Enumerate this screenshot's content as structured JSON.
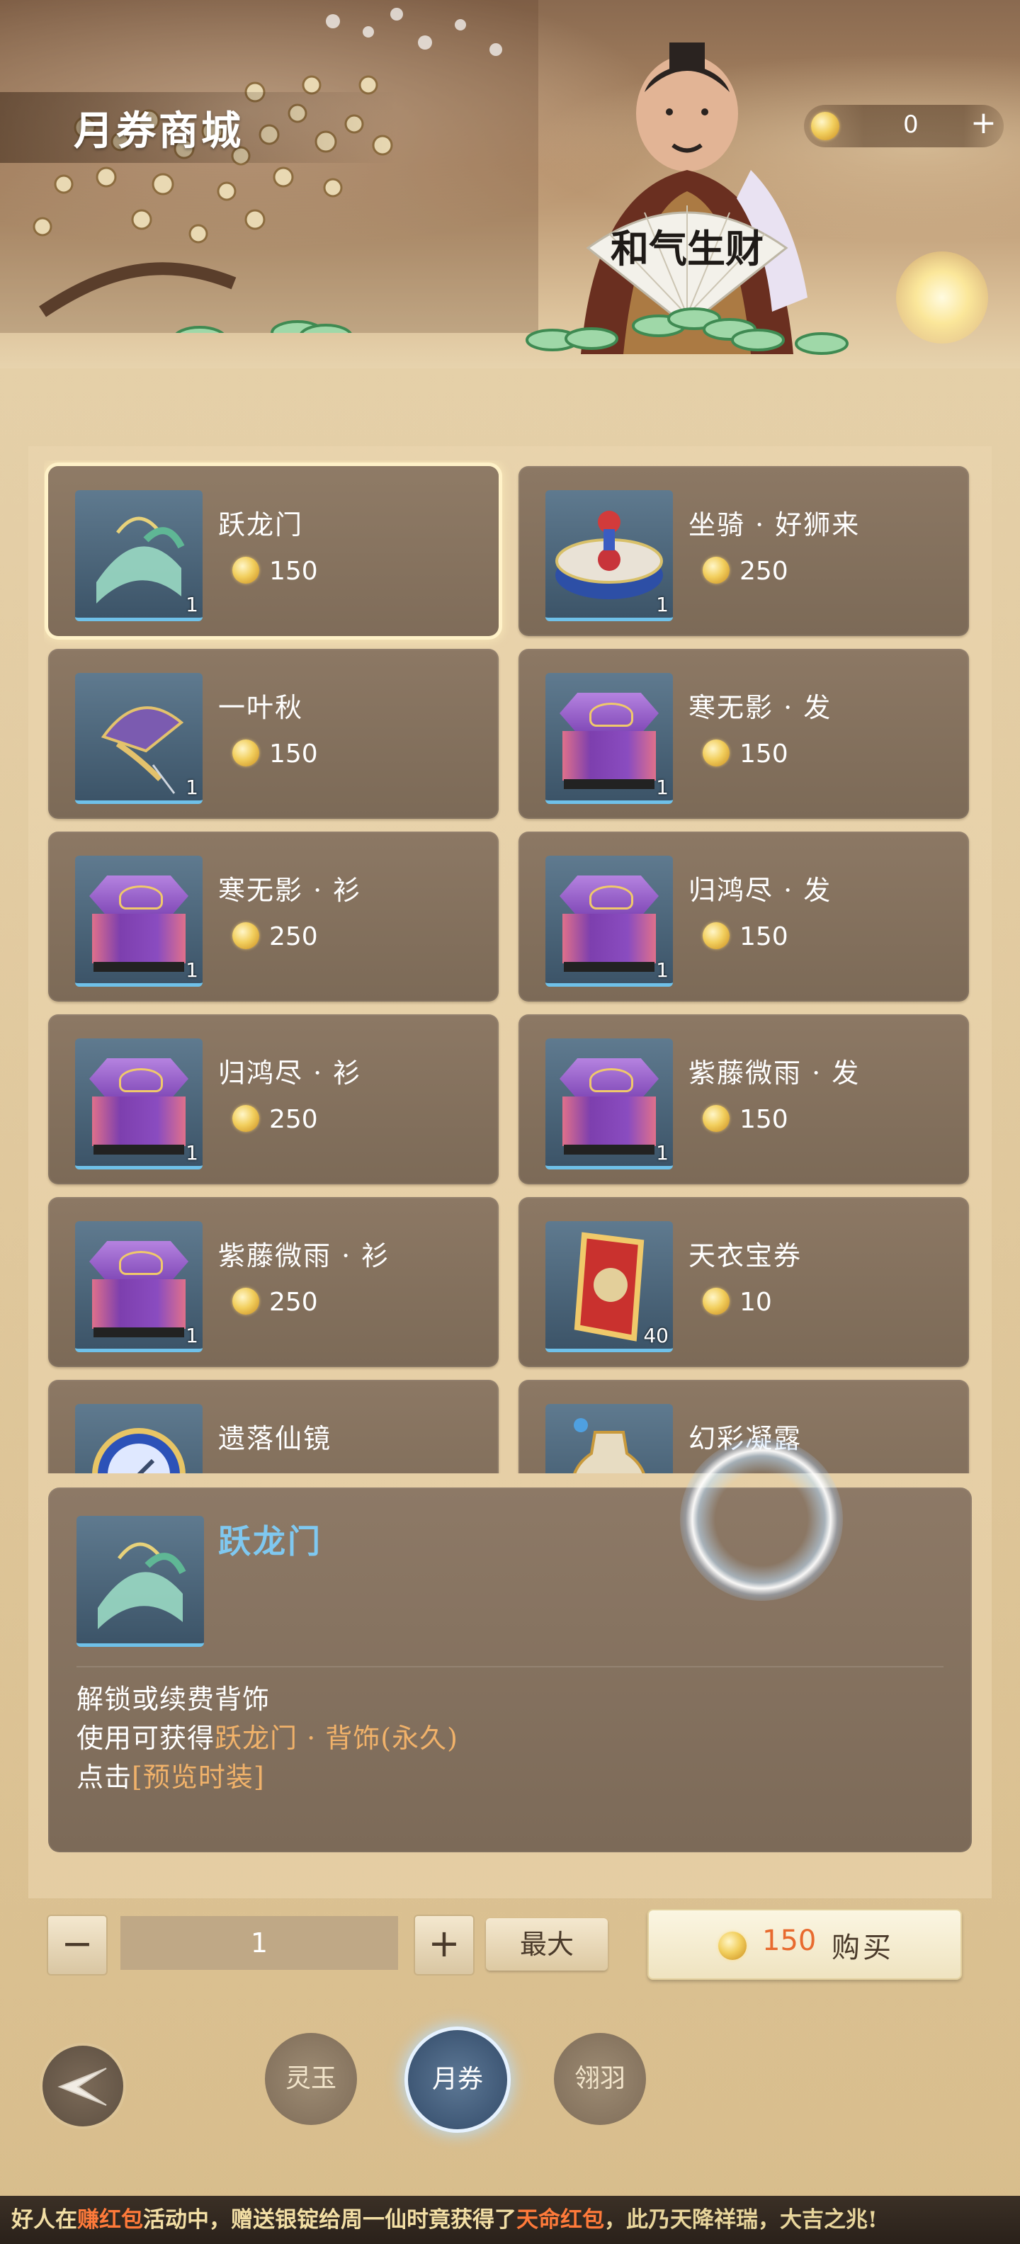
{
  "header": {
    "title": "月券商城",
    "currency_amount": "0",
    "currency_plus": "+",
    "fan_text": "和气生财"
  },
  "items": [
    {
      "name": "跃龙门",
      "price": "150",
      "qty": "1",
      "icon": "jade-headpiece-icon",
      "selected": true
    },
    {
      "name": "坐骑 · 好狮来",
      "price": "250",
      "qty": "1",
      "icon": "lion-drum-mount-icon"
    },
    {
      "name": "一叶秋",
      "price": "150",
      "qty": "1",
      "icon": "fan-ornament-icon"
    },
    {
      "name": "寒无影 · 发",
      "price": "150",
      "qty": "1",
      "icon": "purple-chest-icon"
    },
    {
      "name": "寒无影 · 衫",
      "price": "250",
      "qty": "1",
      "icon": "purple-chest-icon"
    },
    {
      "name": "归鸿尽 · 发",
      "price": "150",
      "qty": "1",
      "icon": "purple-chest-icon"
    },
    {
      "name": "归鸿尽 · 衫",
      "price": "250",
      "qty": "1",
      "icon": "purple-chest-icon"
    },
    {
      "name": "紫藤微雨 · 发",
      "price": "150",
      "qty": "1",
      "icon": "purple-chest-icon"
    },
    {
      "name": "紫藤微雨 · 衫",
      "price": "250",
      "qty": "1",
      "icon": "purple-chest-icon"
    },
    {
      "name": "天衣宝券",
      "price": "10",
      "qty": "40",
      "icon": "scroll-voucher-icon"
    },
    {
      "name": "遗落仙镜",
      "icon": "mirror-icon"
    },
    {
      "name": "幻彩凝露",
      "icon": "vase-icon"
    }
  ],
  "detail": {
    "name": "跃龙门",
    "line1": "解锁或续费背饰",
    "line2_prefix": "使用可获得",
    "line2_highlight": "跃龙门 · 背饰(永久)",
    "line3_prefix": "点击",
    "line3_highlight": "[预览时装]"
  },
  "purchase": {
    "minus": "−",
    "quantity": "1",
    "plus": "+",
    "max_label": "最大",
    "price": "150",
    "buy_label": "购买"
  },
  "nav": {
    "tabs": [
      "灵玉",
      "月券",
      "翎羽"
    ],
    "active_tab": "月券"
  },
  "ticker": {
    "p1": "好人在",
    "p2": "赚红包",
    "p3": "活动中，赠送银锭给周一仙时竟获得了",
    "p4": "天命红包",
    "p5": "，此乃天降祥瑞，大吉之兆!"
  },
  "colors": {
    "highlight": "#f1b26a",
    "detail_name": "#7fc8f0",
    "buy_price": "#e86a2e",
    "card_bg": "#847060"
  }
}
